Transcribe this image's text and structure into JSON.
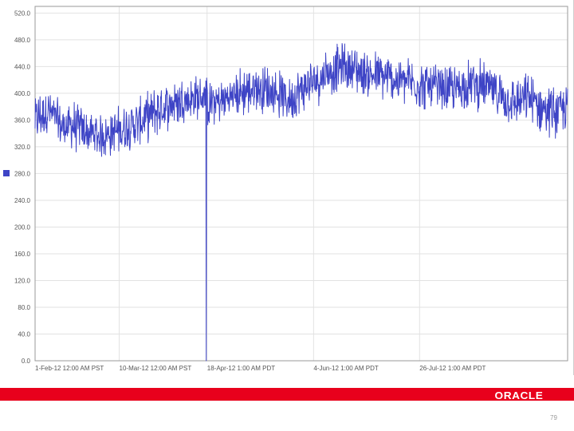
{
  "colors": {
    "series": "#3e44c6",
    "grid": "#e2e2e2",
    "axis": "#9a9a9a",
    "footer_bar": "#e8001c",
    "logo_text": "#ffffff",
    "page_number": "#9a9a9a"
  },
  "footer": {
    "logo_text": "ORACLE",
    "page_number": "79"
  },
  "chart_data": {
    "type": "line",
    "title": "",
    "xlabel": "",
    "ylabel": "",
    "legend": {
      "position": "left",
      "swatch_color": "#3e44c6",
      "label": ""
    },
    "grid": true,
    "ylim": [
      0,
      530
    ],
    "yticks": [
      {
        "value": 0,
        "label": "0.0"
      },
      {
        "value": 40,
        "label": "40.0"
      },
      {
        "value": 80,
        "label": "80.0"
      },
      {
        "value": 120,
        "label": "120.0"
      },
      {
        "value": 160,
        "label": "160.0"
      },
      {
        "value": 200,
        "label": "200.0"
      },
      {
        "value": 240,
        "label": "240.0"
      },
      {
        "value": 280,
        "label": "280.0"
      },
      {
        "value": 320,
        "label": "320.0"
      },
      {
        "value": 360,
        "label": "360.0"
      },
      {
        "value": 400,
        "label": "400.0"
      },
      {
        "value": 440,
        "label": "440.0"
      },
      {
        "value": 480,
        "label": "480.0"
      },
      {
        "value": 520,
        "label": "520.0"
      }
    ],
    "xticks": [
      {
        "t": 0.0,
        "label": "1-Feb-12 12:00 AM PST"
      },
      {
        "t": 0.158,
        "label": "10-Mar-12 12:00 AM PST"
      },
      {
        "t": 0.323,
        "label": "18-Apr-12 1:00 AM PDT"
      },
      {
        "t": 0.523,
        "label": "4-Jun-12 1:00 AM PDT"
      },
      {
        "t": 0.722,
        "label": "26-Jul-12 1:00 AM PDT"
      }
    ],
    "series": [
      {
        "points": [
          [
            0.0,
            360
          ],
          [
            0.025,
            375
          ],
          [
            0.05,
            350
          ],
          [
            0.075,
            352
          ],
          [
            0.1,
            340
          ],
          [
            0.125,
            336
          ],
          [
            0.15,
            342
          ],
          [
            0.175,
            350
          ],
          [
            0.2,
            358
          ],
          [
            0.225,
            372
          ],
          [
            0.25,
            382
          ],
          [
            0.275,
            390
          ],
          [
            0.3,
            392
          ],
          [
            0.315,
            395
          ],
          [
            0.3215,
            0
          ],
          [
            0.328,
            385
          ],
          [
            0.35,
            388
          ],
          [
            0.375,
            398
          ],
          [
            0.4,
            405
          ],
          [
            0.425,
            408
          ],
          [
            0.45,
            402
          ],
          [
            0.475,
            390
          ],
          [
            0.5,
            405
          ],
          [
            0.525,
            418
          ],
          [
            0.55,
            432
          ],
          [
            0.575,
            440
          ],
          [
            0.6,
            436
          ],
          [
            0.625,
            428
          ],
          [
            0.65,
            425
          ],
          [
            0.675,
            420
          ],
          [
            0.7,
            418
          ],
          [
            0.725,
            412
          ],
          [
            0.75,
            408
          ],
          [
            0.775,
            404
          ],
          [
            0.8,
            410
          ],
          [
            0.825,
            415
          ],
          [
            0.85,
            408
          ],
          [
            0.875,
            398
          ],
          [
            0.9,
            385
          ],
          [
            0.925,
            392
          ],
          [
            0.95,
            380
          ],
          [
            0.975,
            372
          ],
          [
            1.0,
            378
          ]
        ],
        "noise_amplitude": 28
      }
    ]
  }
}
